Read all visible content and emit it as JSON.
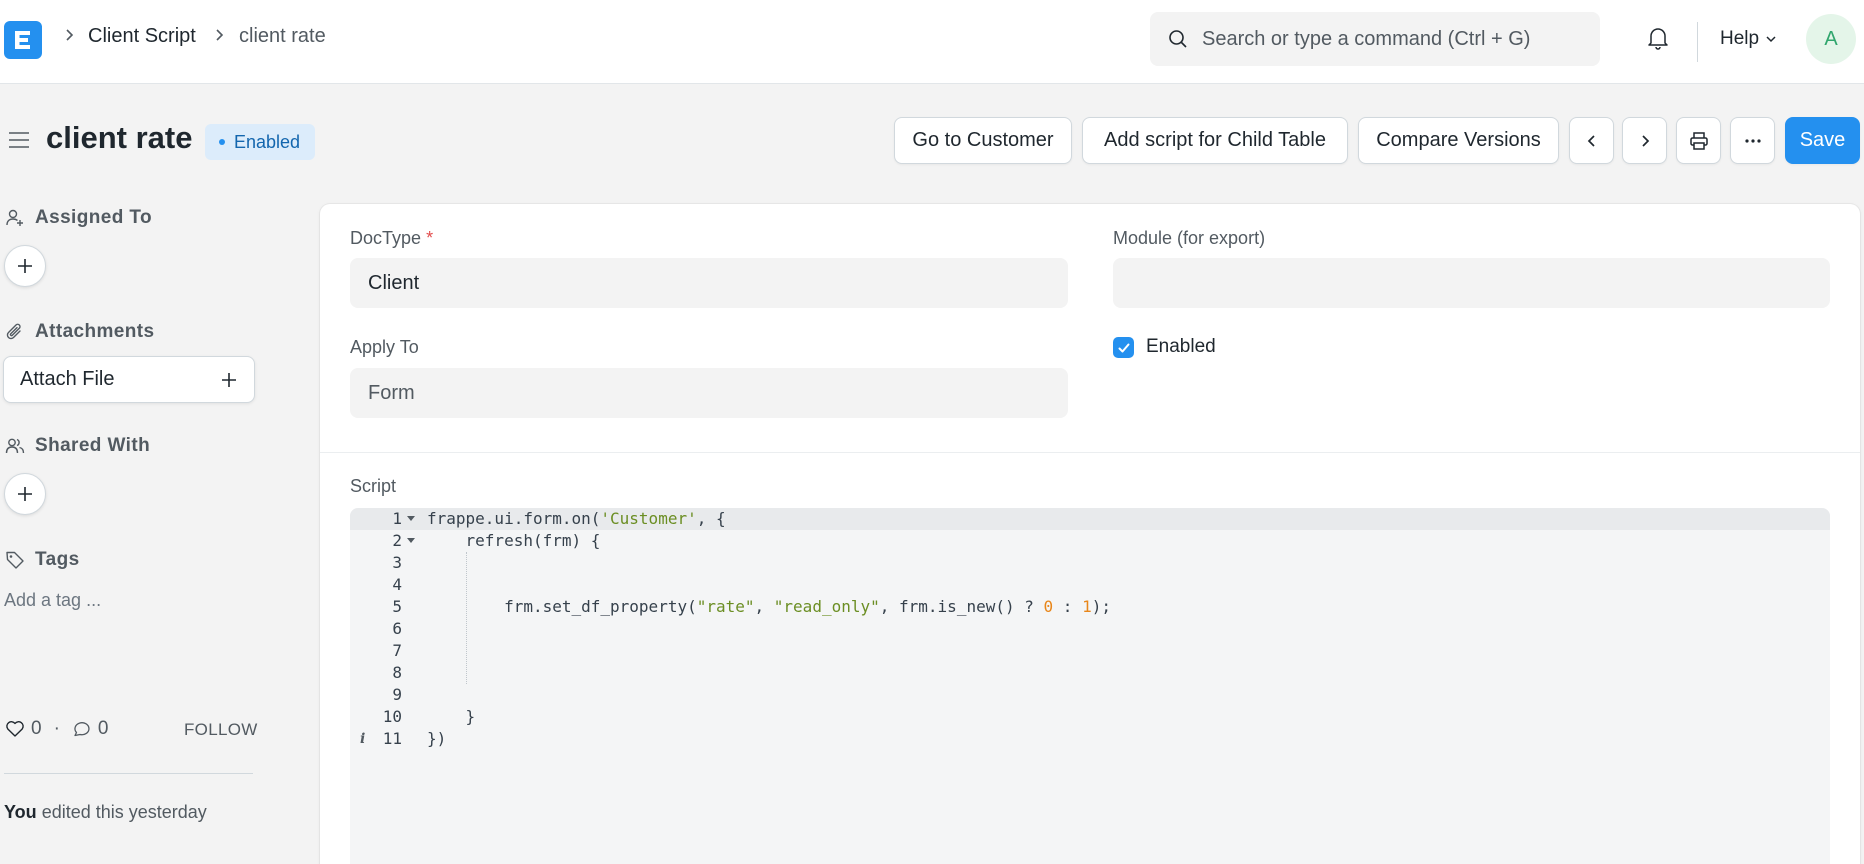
{
  "navbar": {
    "breadcrumbs": [
      "Client Script",
      "client rate"
    ],
    "search_placeholder": "Search or type a command (Ctrl + G)",
    "help_label": "Help",
    "avatar_letter": "A"
  },
  "page": {
    "title": "client rate",
    "status": "Enabled"
  },
  "actions": {
    "go_to_customer": "Go to Customer",
    "add_script_child": "Add script for Child Table",
    "compare_versions": "Compare Versions",
    "save": "Save"
  },
  "sidebar": {
    "assigned_to": "Assigned To",
    "attachments": "Attachments",
    "attach_file": "Attach File",
    "shared_with": "Shared With",
    "tags": "Tags",
    "add_tag": "Add a tag ...",
    "likes": "0",
    "comments": "0",
    "follow": "FOLLOW",
    "activity_user": "You",
    "activity_text": "edited this yesterday"
  },
  "form": {
    "doctype_label": "DocType",
    "doctype_value": "Client",
    "apply_to_label": "Apply To",
    "apply_to_value": "Form",
    "module_label": "Module (for export)",
    "module_value": "",
    "enabled_label": "Enabled",
    "enabled_checked": true,
    "script_label": "Script"
  },
  "script_lines": [
    {
      "num": "1",
      "code": "frappe.ui.form.on('Customer', {"
    },
    {
      "num": "2",
      "code": "    refresh(frm) {"
    },
    {
      "num": "3",
      "code": ""
    },
    {
      "num": "4",
      "code": ""
    },
    {
      "num": "5",
      "code": "        frm.set_df_property(\"rate\", \"read_only\", frm.is_new() ? 0 : 1);"
    },
    {
      "num": "6",
      "code": ""
    },
    {
      "num": "7",
      "code": ""
    },
    {
      "num": "8",
      "code": ""
    },
    {
      "num": "9",
      "code": ""
    },
    {
      "num": "10",
      "code": "    }"
    },
    {
      "num": "11",
      "code": "})"
    }
  ],
  "colors": {
    "primary": "#2490ef",
    "string": "#6b8e23",
    "number": "#e8861a"
  }
}
